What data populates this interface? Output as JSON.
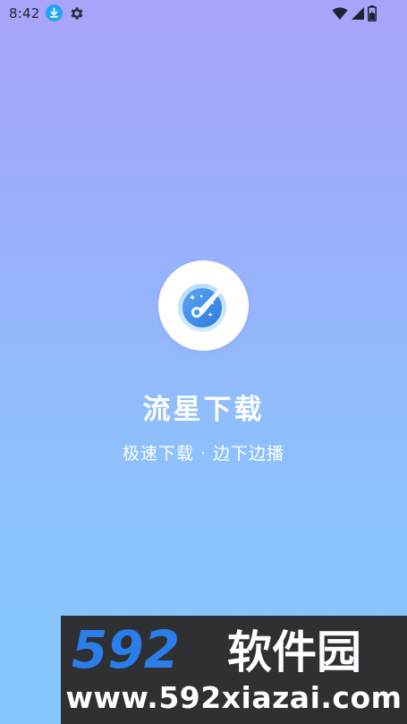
{
  "status_bar": {
    "time": "8:42",
    "icons": [
      "download-notification-icon",
      "gear-icon",
      "wifi-icon",
      "cell-signal-icon",
      "battery-icon"
    ]
  },
  "app": {
    "name": "流星下载",
    "slogan": "极速下载 · 边下边播",
    "logo_icon": "meteor-icon"
  },
  "watermark": {
    "brand_number": "592",
    "brand_text": "软件园",
    "url": "www.592xiazai.com"
  },
  "colors": {
    "gradient_top": "#a9a4fb",
    "gradient_bottom": "#83c8fd",
    "logo_blue": "#3f8ff0",
    "watermark_bg": "#2f3034",
    "watermark_accent": "#2b7de9",
    "status_accent": "#1fa6f3"
  }
}
